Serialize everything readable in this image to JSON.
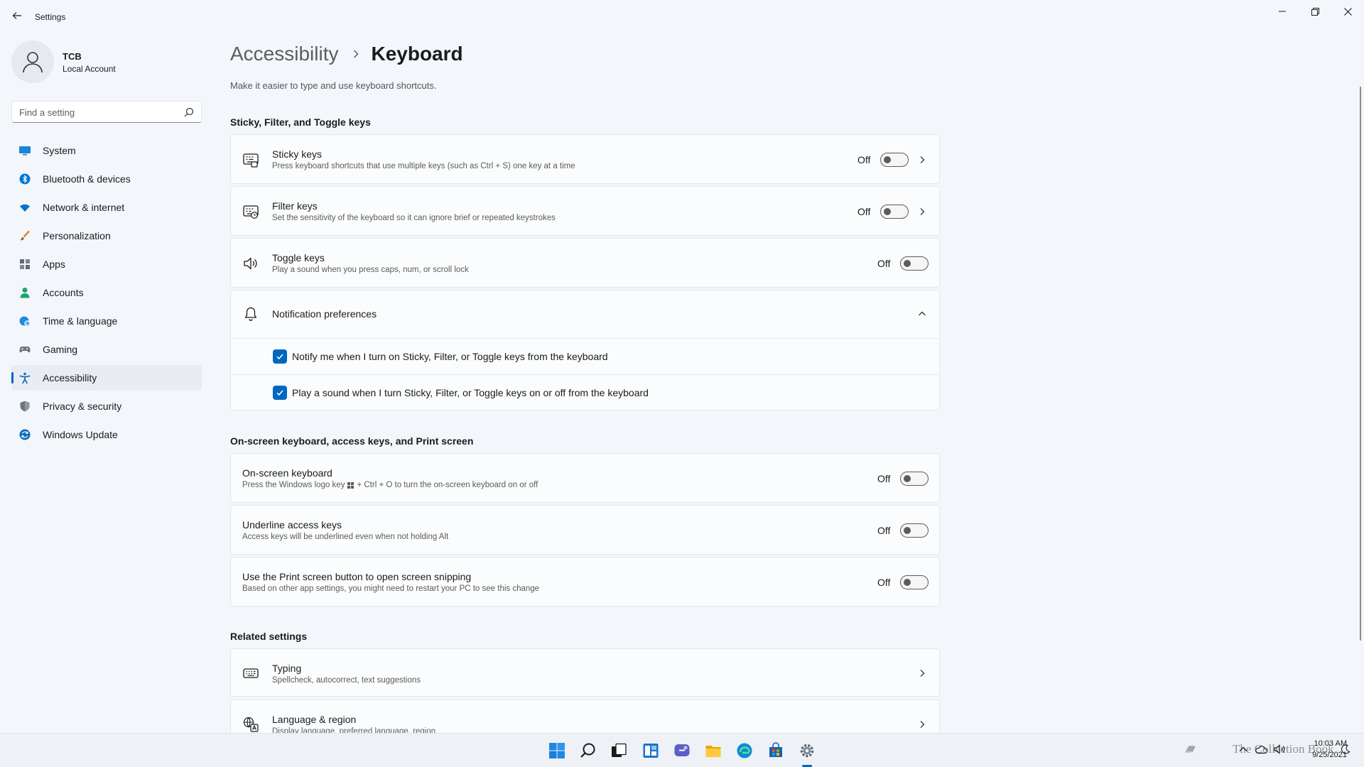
{
  "window": {
    "app_title": "Settings"
  },
  "profile": {
    "name": "TCB",
    "account_type": "Local Account"
  },
  "search": {
    "placeholder": "Find a setting"
  },
  "sidebar": {
    "items": [
      {
        "label": "System",
        "icon": "monitor-icon",
        "color": "#0078d4"
      },
      {
        "label": "Bluetooth & devices",
        "icon": "bluetooth-icon",
        "color": "#0078d4"
      },
      {
        "label": "Network & internet",
        "icon": "wifi-icon",
        "color": "#0a73c9"
      },
      {
        "label": "Personalization",
        "icon": "brush-icon",
        "color": "#d98a1f"
      },
      {
        "label": "Apps",
        "icon": "apps-icon",
        "color": "#5d6b7a"
      },
      {
        "label": "Accounts",
        "icon": "person-icon",
        "color": "#1aa36a"
      },
      {
        "label": "Time & language",
        "icon": "globe-clock-icon",
        "color": "#1c8fd8"
      },
      {
        "label": "Gaming",
        "icon": "gamepad-icon",
        "color": "#6b7580"
      },
      {
        "label": "Accessibility",
        "icon": "accessibility-icon",
        "color": "#0f6cbd"
      },
      {
        "label": "Privacy & security",
        "icon": "shield-icon",
        "color": "#6b7580"
      },
      {
        "label": "Windows Update",
        "icon": "update-icon",
        "color": "#0f6cbd"
      }
    ],
    "active": "Accessibility"
  },
  "breadcrumb": {
    "parent": "Accessibility",
    "current": "Keyboard"
  },
  "page": {
    "description": "Make it easier to type and use keyboard shortcuts."
  },
  "sections": {
    "sticky": {
      "title": "Sticky, Filter, and Toggle keys",
      "sticky_keys": {
        "title": "Sticky keys",
        "subtitle": "Press keyboard shortcuts that use multiple keys (such as Ctrl + S) one key at a time",
        "state": "Off"
      },
      "filter_keys": {
        "title": "Filter keys",
        "subtitle": "Set the sensitivity of the keyboard so it can ignore brief or repeated keystrokes",
        "state": "Off"
      },
      "toggle_keys": {
        "title": "Toggle keys",
        "subtitle": "Play a sound when you press caps, num, or scroll lock",
        "state": "Off"
      },
      "notifications": {
        "title": "Notification preferences",
        "option1": "Notify me when I turn on Sticky, Filter, or Toggle keys from the keyboard",
        "option2": "Play a sound when I turn Sticky, Filter, or Toggle keys on or off from the keyboard"
      }
    },
    "onscreen": {
      "title": "On-screen keyboard, access keys, and Print screen",
      "osk": {
        "title": "On-screen keyboard",
        "subtitle_pre": "Press the Windows logo key",
        "subtitle_post": "+ Ctrl + O to turn the on-screen keyboard on or off",
        "state": "Off"
      },
      "underline": {
        "title": "Underline access keys",
        "subtitle": "Access keys will be underlined even when not holding Alt",
        "state": "Off"
      },
      "printscreen": {
        "title": "Use the Print screen button to open screen snipping",
        "subtitle": "Based on other app settings, you might need to restart your PC to see this change",
        "state": "Off"
      }
    },
    "related": {
      "title": "Related settings",
      "typing": {
        "title": "Typing",
        "subtitle": "Spellcheck, autocorrect, text suggestions"
      },
      "language": {
        "title": "Language & region",
        "subtitle": "Display language, preferred language, region"
      }
    }
  },
  "taskbar": {
    "time": "10:03 AM",
    "date": "9/25/2021"
  },
  "watermark": {
    "text": "The Collection Book"
  },
  "colors": {
    "accent": "#0067c0"
  }
}
